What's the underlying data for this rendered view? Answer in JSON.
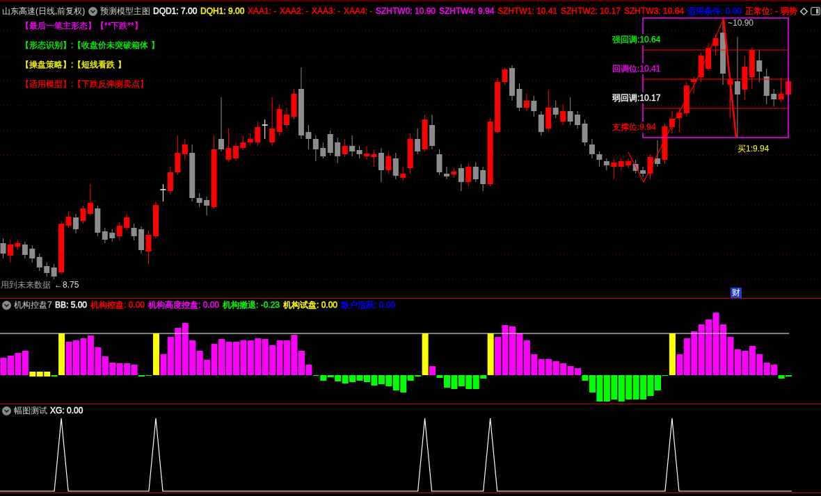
{
  "main_chart": {
    "symbol": "山东高速(日线,前复权)",
    "indicator": "预测模型主图",
    "legend": [
      {
        "text": "DQD1: 7.00",
        "color": "#ffffff"
      },
      {
        "text": "DQH1: 9.00",
        "color": "#ffff00"
      },
      {
        "text": "XAA1: -",
        "color": "#ff0000"
      },
      {
        "text": "XAA2: -",
        "color": "#ff0000"
      },
      {
        "text": "XAA3: -",
        "color": "#ff0000"
      },
      {
        "text": "XAA4: -",
        "color": "#ff0000"
      },
      {
        "text": "SZHTW0: 10.90",
        "color": "#ff00ff"
      },
      {
        "text": "SZHTW4: 9.94",
        "color": "#ff00ff"
      },
      {
        "text": "SZHTW1: 10.41",
        "color": "#ff0000"
      },
      {
        "text": "SZHTW2: 10.17",
        "color": "#ff0000"
      },
      {
        "text": "SZHTW3: 10.64",
        "color": "#ff0000"
      },
      {
        "text": "适用条件: 0.00",
        "color": "#0000ff"
      },
      {
        "text": "正常位: -",
        "color": "#ff0000"
      },
      {
        "text": "弱势",
        "color": "#ff0000"
      }
    ],
    "signals": [
      {
        "text": "【最后一笔主形态】【**下跌**】",
        "color": "#ff00ff"
      },
      {
        "text": "【形态识别】:【收盘价未突破箱体 】",
        "color": "#00ff00"
      },
      {
        "text": "【操盘策略】:【短线看跌 】",
        "color": "#ffff00"
      },
      {
        "text": "【适用模型】:【下跌反弹测卖点】",
        "color": "#ff0000"
      }
    ],
    "box_levels": [
      {
        "text": "强回调:10.64",
        "color": "#00ff00"
      },
      {
        "text": "回调位:10.41",
        "color": "#ff00ff"
      },
      {
        "text": "弱回调:10.17",
        "color": "#ffffff"
      },
      {
        "text": "支撑位:9.94",
        "color": "#ff0000"
      }
    ],
    "peak_label": "~10.90",
    "buy_label": "买1:9.94",
    "low_label": "←8.75",
    "future_data_note": "用到未来数据",
    "badge": "财"
  },
  "indicator_panels": [
    {
      "kind": "bars",
      "name": "机构控盘7",
      "legend": [
        {
          "text": "BB: 5.00",
          "color": "#ffffff"
        },
        {
          "text": "机构控盘: 0.00",
          "color": "#ff0000"
        },
        {
          "text": "机构高度控盘: 0.00",
          "color": "#ff00ff"
        },
        {
          "text": "机构撤退: -0.23",
          "color": "#00ff00"
        },
        {
          "text": "机构试盘: 0.00",
          "color": "#ffff00"
        },
        {
          "text": "散户活跃: 0.00",
          "color": "#0000ff"
        }
      ]
    },
    {
      "kind": "spikes",
      "name": "幅图测试",
      "legend": [
        {
          "text": "XG: 0.00",
          "color": "#ffffff"
        }
      ]
    }
  ]
}
